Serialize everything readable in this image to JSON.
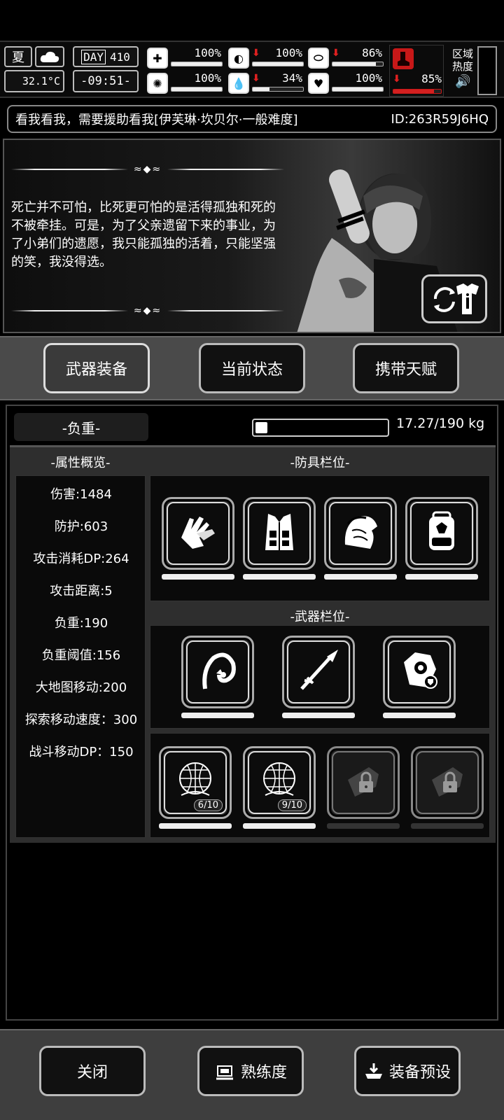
{
  "hud": {
    "season": "夏",
    "temperature": "32.1°C",
    "day_label": "DAY",
    "day_value": "410",
    "time": "-09:51-",
    "stats": [
      {
        "name": "health",
        "value": "100%",
        "level": 1.0,
        "down": false
      },
      {
        "name": "stomach",
        "value": "100%",
        "level": 1.0,
        "down": true
      },
      {
        "name": "medicine",
        "value": "86%",
        "level": 0.86,
        "down": true
      },
      {
        "name": "brain",
        "value": "100%",
        "level": 1.0,
        "down": false
      },
      {
        "name": "water",
        "value": "34%",
        "level": 0.34,
        "down": true
      },
      {
        "name": "heart",
        "value": "100%",
        "level": 1.0,
        "down": false
      }
    ],
    "stamina": {
      "value": "85%",
      "level": 0.85,
      "down": true
    },
    "zone_heat_label": "区域热度"
  },
  "banner": {
    "title": "看我看我，需要援助看我[伊芙琳·坎贝尔·一般难度]",
    "id": "ID:263R59J6HQ"
  },
  "story": {
    "text": "死亡并不可怕，比死更可怕的是活得孤独和死的不被牵挂。可是，为了父亲遗留下来的事业，为了小弟们的遗愿，我只能孤独的活着，只能坚强的笑，我没得选。"
  },
  "tabs": [
    "武器装备",
    "当前状态",
    "携带天赋"
  ],
  "weight": {
    "label": "-负重-",
    "value": "17.27/190 kg",
    "fraction": 0.091
  },
  "attributes": {
    "title": "-属性概览-",
    "items": [
      "伤害:1484",
      "防护:603",
      "攻击消耗DP:264",
      "攻击距离:5",
      "负重:190",
      "负重阈值:156",
      "大地图移动:200",
      "探索移动速度：300",
      "战斗移动DP：150"
    ]
  },
  "armor": {
    "title": "-防具栏位-",
    "slots": [
      {
        "icon": "gloves-icon"
      },
      {
        "icon": "vest-icon"
      },
      {
        "icon": "horse-shoulder-armor-icon"
      },
      {
        "icon": "backpack-icon"
      }
    ]
  },
  "weapons": {
    "title": "-武器栏位-",
    "slots": [
      {
        "icon": "scorpion-whip-icon"
      },
      {
        "icon": "spear-icon"
      },
      {
        "icon": "shield-gauntlet-icon"
      }
    ]
  },
  "items": {
    "slots": [
      {
        "icon": "net-icon",
        "count": "6/10"
      },
      {
        "icon": "net-icon",
        "count": "9/10"
      },
      {
        "icon": "locked-slot-icon",
        "count": ""
      },
      {
        "icon": "locked-slot-icon",
        "count": ""
      }
    ]
  },
  "bottom": {
    "close": "关闭",
    "proficiency": "熟练度",
    "preset": "装备预设"
  }
}
